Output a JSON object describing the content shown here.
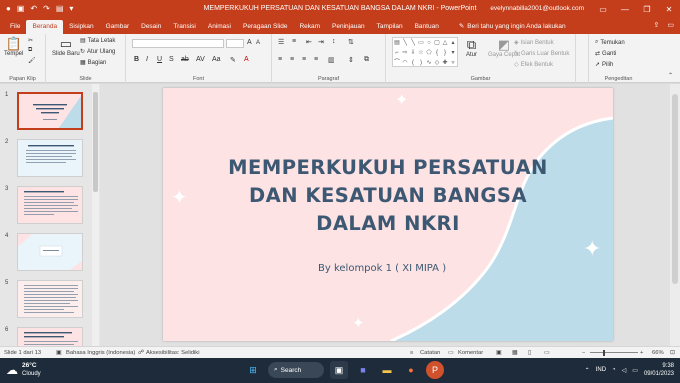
{
  "window": {
    "title": "MEMPERKUKUH PERSATUAN DAN KESATUAN BANGSA DALAM NKRI  -  PowerPoint",
    "account": "evelynnabilla2001@outlook.com"
  },
  "tabs": [
    {
      "label": "File"
    },
    {
      "label": "Beranda"
    },
    {
      "label": "Sisipkan"
    },
    {
      "label": "Gambar"
    },
    {
      "label": "Desain"
    },
    {
      "label": "Transisi"
    },
    {
      "label": "Animasi"
    },
    {
      "label": "Peragaan Slide"
    },
    {
      "label": "Rekam"
    },
    {
      "label": "Peninjauan"
    },
    {
      "label": "Tampilan"
    },
    {
      "label": "Bantuan"
    }
  ],
  "tell_me": "Beri tahu yang ingin Anda lakukan",
  "ribbon": {
    "clipboard": {
      "paste": "Tempel",
      "label": "Papan Klip"
    },
    "slides": {
      "new_slide": "Slide Baru",
      "layout": "Tata Letak",
      "reset": "Atur Ulang",
      "section": "Bagian",
      "label": "Slide"
    },
    "font": {
      "label": "Font"
    },
    "paragraph": {
      "label": "Paragraf"
    },
    "drawing": {
      "arrange": "Atur",
      "quick_styles": "Gaya Cepat",
      "shape_fill": "Isian Bentuk",
      "shape_outline": "Garis Luar Bentuk",
      "shape_effects": "Efek Bentuk",
      "label": "Gambar"
    },
    "editing": {
      "find": "Temukan",
      "replace": "Ganti",
      "select": "Pilih",
      "label": "Pengeditan"
    }
  },
  "thumbnails": [
    {
      "num": "1",
      "selected": true
    },
    {
      "num": "2",
      "selected": false
    },
    {
      "num": "3",
      "selected": false
    },
    {
      "num": "4",
      "selected": false
    },
    {
      "num": "5",
      "selected": false
    },
    {
      "num": "6",
      "selected": false
    }
  ],
  "slide": {
    "title": "MEMPERKUKUH PERSATUAN\nDAN KESATUAN BANGSA\nDALAM NKRI",
    "subtitle": "By kelompok 1 ( XI MIPA )",
    "colors": {
      "background": "#fde3e4",
      "wave": "#bcdcea",
      "text": "#3d5872"
    }
  },
  "statusbar": {
    "slide_count": "Slide 1 dari 13",
    "language": "Bahasa Inggris (Indonesia)",
    "accessibility": "Aksesibilitas: Selidiki",
    "notes": "Catatan",
    "comments": "Komentar",
    "zoom": "66%"
  },
  "taskbar": {
    "temperature": "26°C",
    "weather": "Cloudy",
    "search": "Search",
    "lang": "IND",
    "time": "9:38",
    "date": "09/01/2023"
  },
  "theme": {
    "accent": "#c43e1c"
  }
}
